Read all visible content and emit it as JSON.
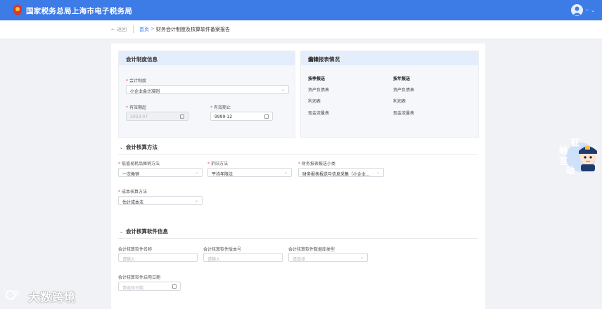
{
  "header": {
    "title": "国家税务总局上海市电子税务局",
    "avatar_icon": "user-avatar-icon",
    "more_label": "·· ⌄"
  },
  "breadcrumb": {
    "back": "← 返回",
    "home": "首页",
    "separator": ">",
    "current": "财务会计制度及核算软件备案报告"
  },
  "accounting_system": {
    "title": "会计制度信息",
    "system_label": "会计制度",
    "system_value": "小企业会计准则",
    "start_label": "有效期起",
    "start_value": "2023-07",
    "end_label": "有效期止",
    "end_value": "9999-12"
  },
  "reports": {
    "title": "会计报表情况",
    "edit": "编辑",
    "quarterly_title": "按季报送",
    "annual_title": "按年报送",
    "quarterly": [
      "资产负债表",
      "利润表",
      "现金流量表"
    ],
    "annual": [
      "资产负债表",
      "利润表",
      "现金流量表"
    ]
  },
  "methods": {
    "title": "会计核算方法",
    "low_value_label": "低值易耗品摊销方法",
    "low_value_value": "一次摊销",
    "depreciation_label": "折旧方法",
    "depreciation_value": "平均年限法",
    "report_category_label": "财务报表报送小类",
    "report_category_value": "财务报表报送与信息采集（小企业...",
    "cost_label": "成本核算方法",
    "cost_value": "估计成本法"
  },
  "software": {
    "title": "会计核算软件信息",
    "name_label": "会计核算软件名称",
    "name_placeholder": "请输入",
    "version_label": "会计核算软件版本号",
    "version_placeholder": "请输入",
    "db_label": "会计核算软件数据库类型",
    "db_placeholder": "请选择",
    "date_label": "会计核算软件启用日期",
    "date_placeholder": "请选择日期"
  },
  "mascot": {
    "text": [
      "征",
      "纳",
      "互",
      "动"
    ]
  },
  "watermark": {
    "text": "大数跨境"
  },
  "colors": {
    "primary": "#3d7be6",
    "required": "#e34d4d",
    "card_header": "#e4edfb"
  }
}
